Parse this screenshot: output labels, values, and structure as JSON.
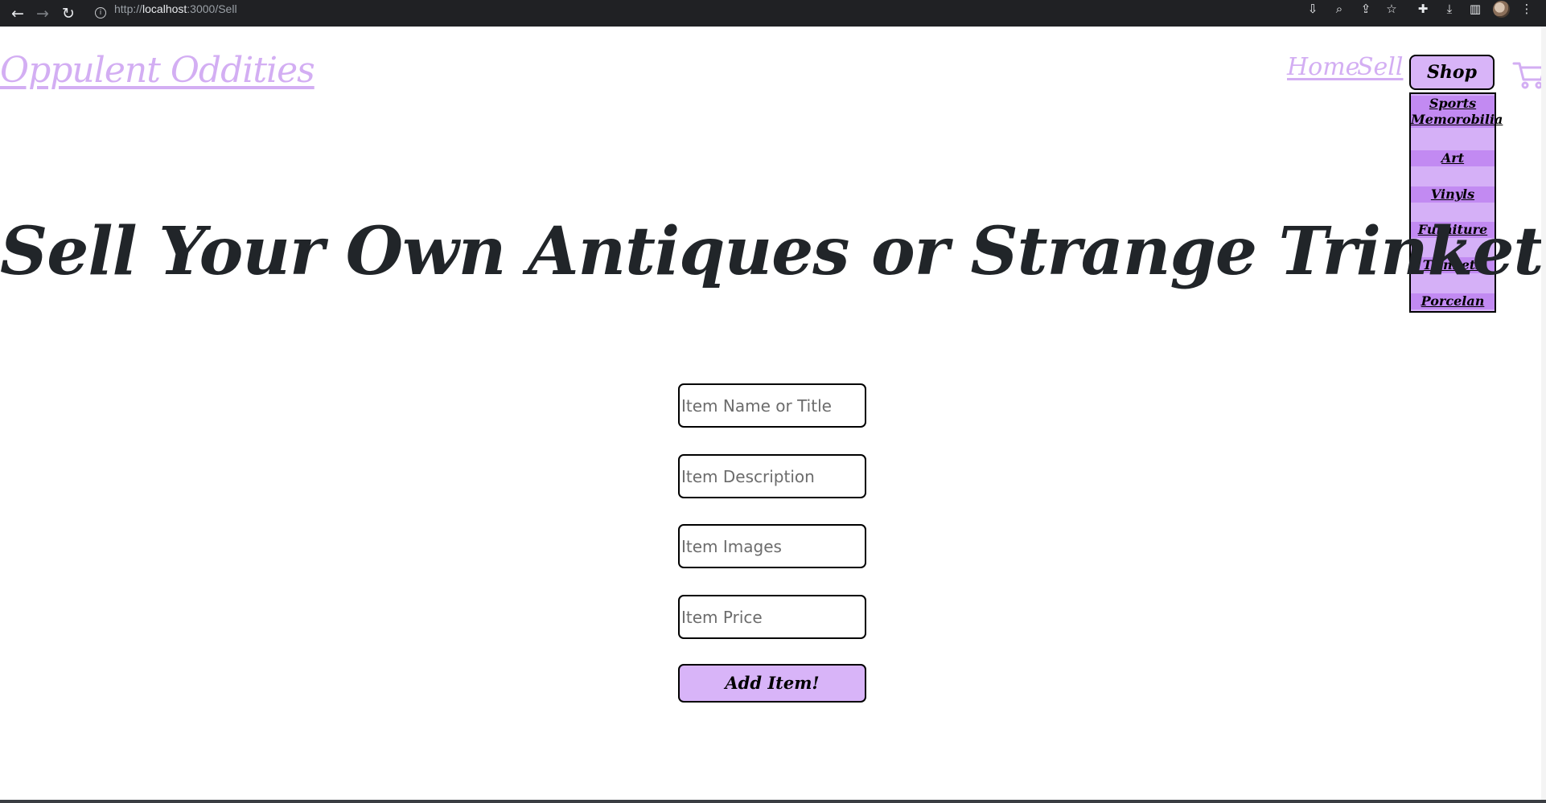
{
  "browser": {
    "url_prefix": "http://",
    "url_host": "localhost",
    "url_rest": ":3000/Sell",
    "icons": [
      "back-arrow-icon",
      "forward-arrow-icon",
      "reload-icon",
      "info-icon",
      "install-icon",
      "zoom-icon",
      "share-icon",
      "bookmark-star-icon",
      "extensions-puzzle-icon",
      "download-icon",
      "side-panel-icon",
      "profile-avatar",
      "kebab-menu-icon"
    ]
  },
  "header": {
    "logo": "Oppulent Oddities",
    "nav": {
      "home": "Home",
      "sell": "Sell",
      "shop": "Shop"
    },
    "shop_menu": {
      "items": [
        "Sports Memorobilia",
        "Art",
        "Vinyls",
        "Furniture",
        "Trinkets",
        "Porcelan"
      ]
    },
    "cart_icon": "shopping-cart-icon"
  },
  "main": {
    "title": "Sell Your Own Antiques or Strange Trinkets!",
    "form": {
      "name_placeholder": "Item Name or Title",
      "description_placeholder": "Item Description",
      "images_placeholder": "Item Images",
      "price_placeholder": "Item Price",
      "submit_label": "Add Item!"
    }
  },
  "colors": {
    "accent": "#d8b4f8",
    "link": "#d3aef3",
    "menu_item": "#c28af2",
    "title_text": "#212529",
    "chrome_bg": "#202124"
  }
}
